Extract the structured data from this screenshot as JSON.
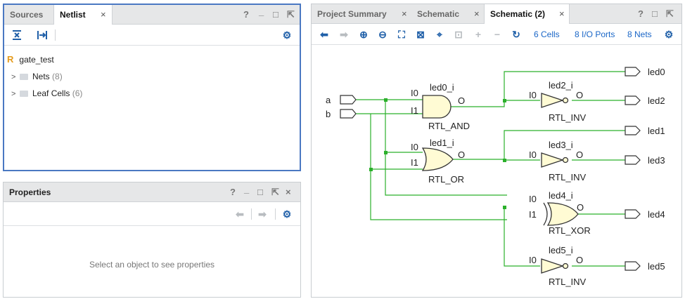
{
  "netlist_panel": {
    "tabs": [
      {
        "label": "Sources",
        "selected": false
      },
      {
        "label": "Netlist",
        "selected": true
      }
    ],
    "close_glyph": "×",
    "window_controls": [
      "?",
      "_",
      "□",
      "⇱"
    ],
    "toolbar_icons": [
      "collapse-all-icon",
      "expand-icon",
      "gear-icon"
    ],
    "tree": {
      "root": {
        "badge": "R",
        "label": "gate_test"
      },
      "children": [
        {
          "label": "Nets",
          "count": "(8)"
        },
        {
          "label": "Leaf Cells",
          "count": "(6)"
        }
      ]
    }
  },
  "properties_panel": {
    "title": "Properties",
    "window_controls": [
      "?",
      "_",
      "□",
      "⇱",
      "×"
    ],
    "toolbar_icons": [
      "back-arrow-icon",
      "forward-arrow-icon",
      "gear-icon"
    ],
    "placeholder": "Select an object to see properties"
  },
  "schematic_panel": {
    "tabs": [
      {
        "label": "Project Summary",
        "selected": false
      },
      {
        "label": "Schematic",
        "selected": false
      },
      {
        "label": "Schematic (2)",
        "selected": true
      }
    ],
    "close_glyph": "×",
    "window_controls": [
      "?",
      "□",
      "⇱"
    ],
    "toolbar_icons": [
      "back-icon",
      "forward-icon",
      "zoom-in-icon",
      "zoom-out-icon",
      "fit-icon",
      "zoom-area-icon",
      "crosshair-icon",
      "regenerate-icon",
      "add-icon",
      "remove-icon",
      "reload-icon",
      "gear-icon"
    ],
    "stats": {
      "cells": "6 Cells",
      "io_ports": "8 I/O Ports",
      "nets": "8 Nets"
    },
    "colors": {
      "wire": "#2bb02b",
      "gate_fill": "#fffbd4",
      "gate_stroke": "#333333"
    },
    "inputs": [
      "a",
      "b"
    ],
    "outputs": [
      "led0",
      "led2",
      "led1",
      "led3",
      "led4",
      "led5"
    ],
    "cells": [
      {
        "instance": "led0_i",
        "type": "RTL_AND",
        "pins": [
          "I0",
          "I1",
          "O"
        ]
      },
      {
        "instance": "led1_i",
        "type": "RTL_OR",
        "pins": [
          "I0",
          "I1",
          "O"
        ]
      },
      {
        "instance": "led2_i",
        "type": "RTL_INV",
        "pins": [
          "I0",
          "O"
        ]
      },
      {
        "instance": "led3_i",
        "type": "RTL_INV",
        "pins": [
          "I0",
          "O"
        ]
      },
      {
        "instance": "led4_i",
        "type": "RTL_XOR",
        "pins": [
          "I0",
          "I1",
          "O"
        ]
      },
      {
        "instance": "led5_i",
        "type": "RTL_INV",
        "pins": [
          "I0",
          "O"
        ]
      }
    ]
  },
  "accent": "#4a78c2"
}
